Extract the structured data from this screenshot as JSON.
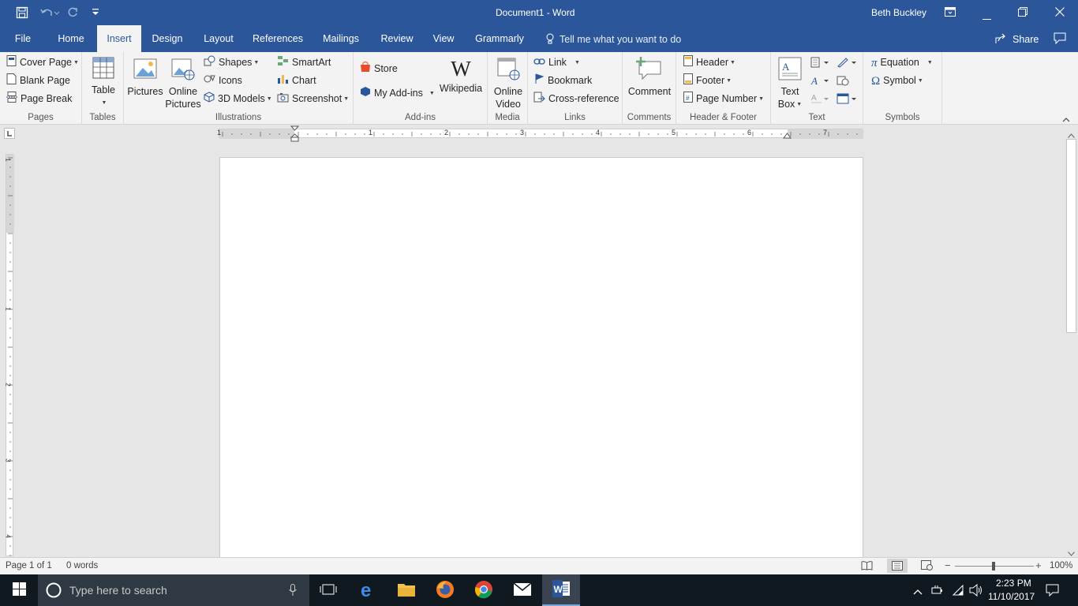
{
  "window": {
    "title": "Document1  -  Word",
    "user": "Beth Buckley"
  },
  "tabs": [
    {
      "label": "File"
    },
    {
      "label": "Home"
    },
    {
      "label": "Insert"
    },
    {
      "label": "Design"
    },
    {
      "label": "Layout"
    },
    {
      "label": "References"
    },
    {
      "label": "Mailings"
    },
    {
      "label": "Review"
    },
    {
      "label": "View"
    },
    {
      "label": "Grammarly"
    }
  ],
  "tell_me": "Tell me what you want to do",
  "share_label": "Share",
  "ribbon": {
    "pages": {
      "label": "Pages",
      "cover": "Cover Page",
      "blank": "Blank Page",
      "break": "Page Break"
    },
    "tables": {
      "label": "Tables",
      "table": "Table"
    },
    "illustrations": {
      "label": "Illustrations",
      "pictures": "Pictures",
      "online_pictures_1": "Online",
      "online_pictures_2": "Pictures",
      "shapes": "Shapes",
      "icons": "Icons",
      "models": "3D Models",
      "smartart": "SmartArt",
      "chart": "Chart",
      "screenshot": "Screenshot"
    },
    "addins": {
      "label": "Add-ins",
      "store": "Store",
      "myaddins": "My Add-ins",
      "wikipedia": "Wikipedia"
    },
    "media": {
      "label": "Media",
      "video_1": "Online",
      "video_2": "Video"
    },
    "links": {
      "label": "Links",
      "link": "Link",
      "bookmark": "Bookmark",
      "crossref": "Cross-reference"
    },
    "comments": {
      "label": "Comments",
      "comment": "Comment"
    },
    "headerfooter": {
      "label": "Header & Footer",
      "header": "Header",
      "footer": "Footer",
      "pagenumber": "Page Number"
    },
    "text": {
      "label": "Text",
      "textbox_1": "Text",
      "textbox_2": "Box"
    },
    "symbols": {
      "label": "Symbols",
      "equation": "Equation",
      "symbol": "Symbol"
    }
  },
  "ruler": {
    "h_numbers": [
      "1",
      "1",
      "2",
      "3",
      "4",
      "5",
      "6",
      "7"
    ],
    "v_numbers": [
      "1",
      "1",
      "2",
      "3",
      "4"
    ]
  },
  "status": {
    "page": "Page 1 of 1",
    "words": "0 words",
    "zoom": "100%"
  },
  "taskbar": {
    "search_placeholder": "Type here to search",
    "time": "2:23 PM",
    "date": "11/10/2017"
  }
}
